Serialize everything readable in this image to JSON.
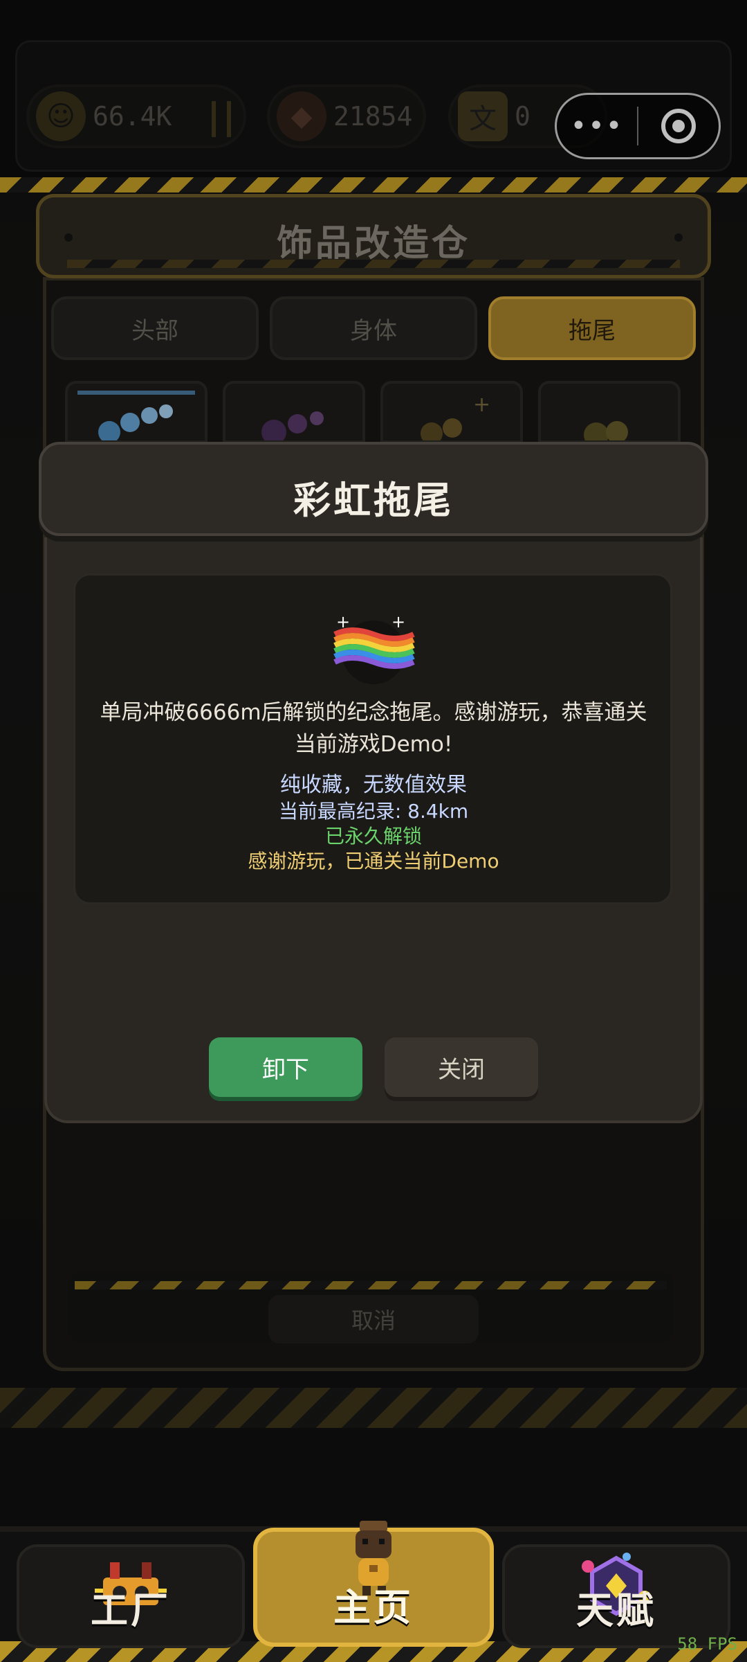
{
  "resources": {
    "coins": "66.4K",
    "gems": "21854",
    "third": "0"
  },
  "workshop": {
    "title": "饰品改造仓",
    "tabs": [
      {
        "label": "头部",
        "active": false
      },
      {
        "label": "身体",
        "active": false
      },
      {
        "label": "拖尾",
        "active": true
      }
    ],
    "cancel_label": "取消"
  },
  "modal": {
    "title": "彩虹拖尾",
    "description": "单局冲破6666m后解锁的纪念拖尾。感谢游玩，恭喜通关当前游戏Demo!",
    "note": "纯收藏，无数值效果",
    "record": "当前最高纪录: 8.4km",
    "status": "已永久解锁",
    "thanks": "感谢游玩，已通关当前Demo",
    "unequip_label": "卸下",
    "close_label": "关闭",
    "colors": {
      "note": "#c8d8ff",
      "status": "#6bd36b",
      "thanks": "#f0cf74",
      "unequip": "#3e9a5a"
    }
  },
  "nav": {
    "items": [
      {
        "label": "工厂",
        "icon": "factory-icon",
        "active": false
      },
      {
        "label": "主页",
        "icon": "robot-icon",
        "active": true
      },
      {
        "label": "天赋",
        "icon": "talent-icon",
        "active": false
      }
    ]
  },
  "fps": "58 FPS"
}
